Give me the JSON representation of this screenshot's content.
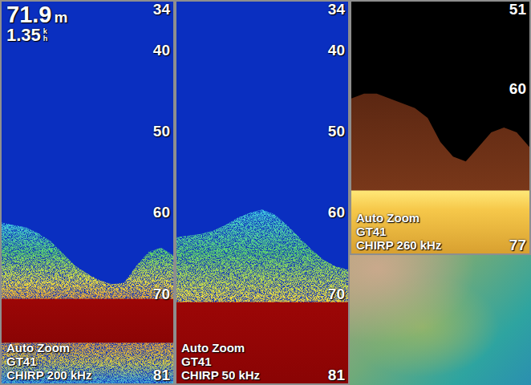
{
  "readout": {
    "depth": {
      "value": "71.9",
      "unit": "m"
    },
    "speed": {
      "value": "1.35",
      "unit_top": "k",
      "unit_bottom": "h"
    }
  },
  "panels": [
    {
      "kind": "blue",
      "scale": [
        "34",
        "40",
        "50",
        "60",
        "70",
        "81"
      ],
      "captions": [
        "Auto Zoom",
        "GT41",
        "CHIRP 200 kHz"
      ],
      "returns_top": [
        61.2,
        61.5,
        61.8,
        62.5,
        63.5,
        65,
        66.5,
        67.5,
        68.3,
        68.8,
        68.6,
        66.5,
        64.8,
        64.3,
        65.2
      ],
      "hard_bottom": 70.6,
      "hard_bottom_end": 76
    },
    {
      "kind": "blue",
      "scale": [
        "34",
        "40",
        "50",
        "60",
        "70",
        "81"
      ],
      "captions": [
        "Auto Zoom",
        "GT41",
        "CHIRP 50 kHz"
      ],
      "returns_top": [
        63,
        62.8,
        62.6,
        62.2,
        61.5,
        60.6,
        60,
        59.6,
        60.2,
        61.5,
        63,
        64.5,
        65.8,
        66.6,
        67
      ],
      "hard_bottom": 71,
      "hard_bottom_end": 81
    },
    {
      "kind": "amber",
      "scale": [
        "51",
        "60",
        "77"
      ],
      "captions": [
        "Auto Zoom",
        "GT41",
        "CHIRP 260 kHz"
      ],
      "returns_top": [
        61,
        60.5,
        60.5,
        61,
        61.5,
        62,
        63,
        65.5,
        67,
        67.5,
        66,
        64.5,
        64,
        64.5,
        66
      ],
      "hard_bottom": 70.5,
      "hard_bottom_end": 77
    }
  ]
}
